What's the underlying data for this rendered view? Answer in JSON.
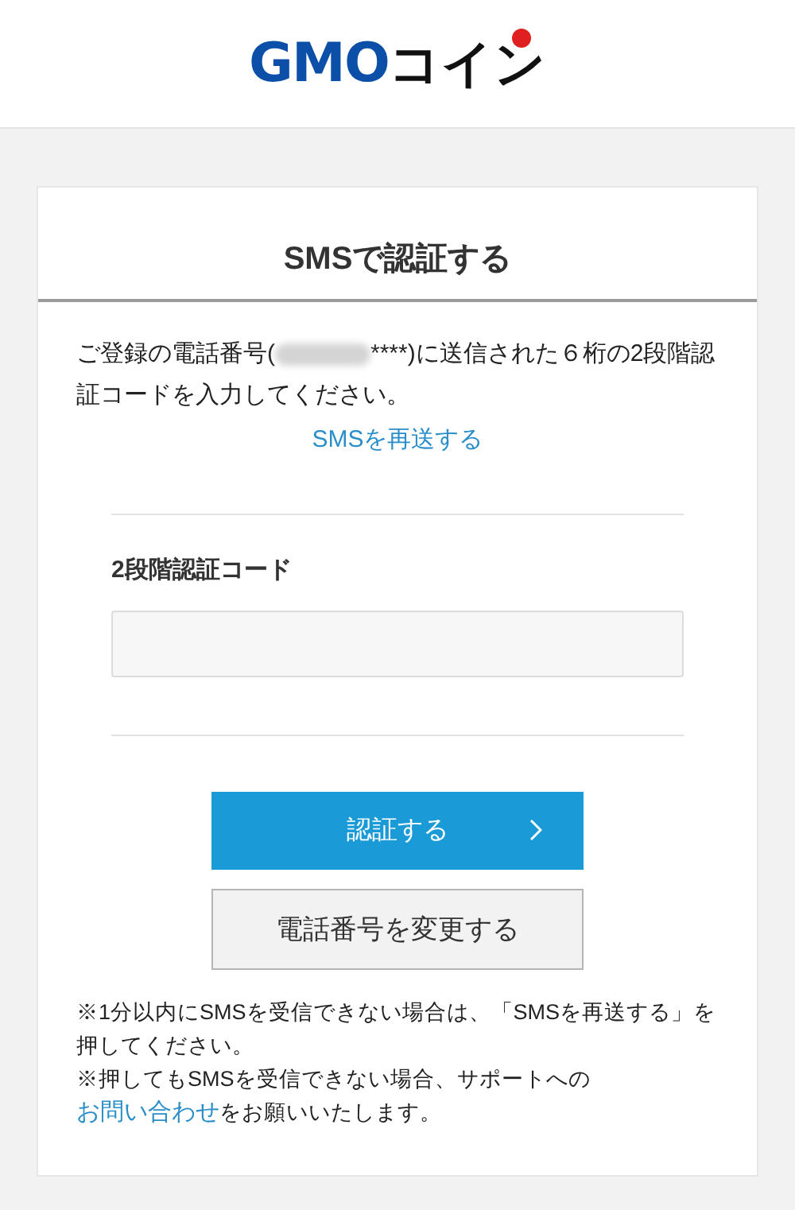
{
  "logo": {
    "brand": "GMO",
    "suffix": "コイン"
  },
  "card": {
    "title": "SMSで認証する",
    "instruction": {
      "before": "ご登録の電話番号(",
      "masked": true,
      "after": "****)に送信された６桁の2段階認証コードを入力してください。"
    },
    "resend_link": "SMSを再送する",
    "code_field": {
      "label": "2段階認証コード"
    },
    "buttons": [
      {
        "kind": "primary",
        "label": "認証する"
      },
      {
        "kind": "secondary",
        "label": "電話番号を変更する"
      }
    ],
    "notes": [
      {
        "before": "※1分以内にSMSを受信できない場合は、「SMSを再送する」を押してください。"
      },
      {
        "before": "※押してもSMSを受信できない場合、サポートへの",
        "link": "お問い合わせ",
        "after": "をお願いいたします。"
      }
    ]
  }
}
